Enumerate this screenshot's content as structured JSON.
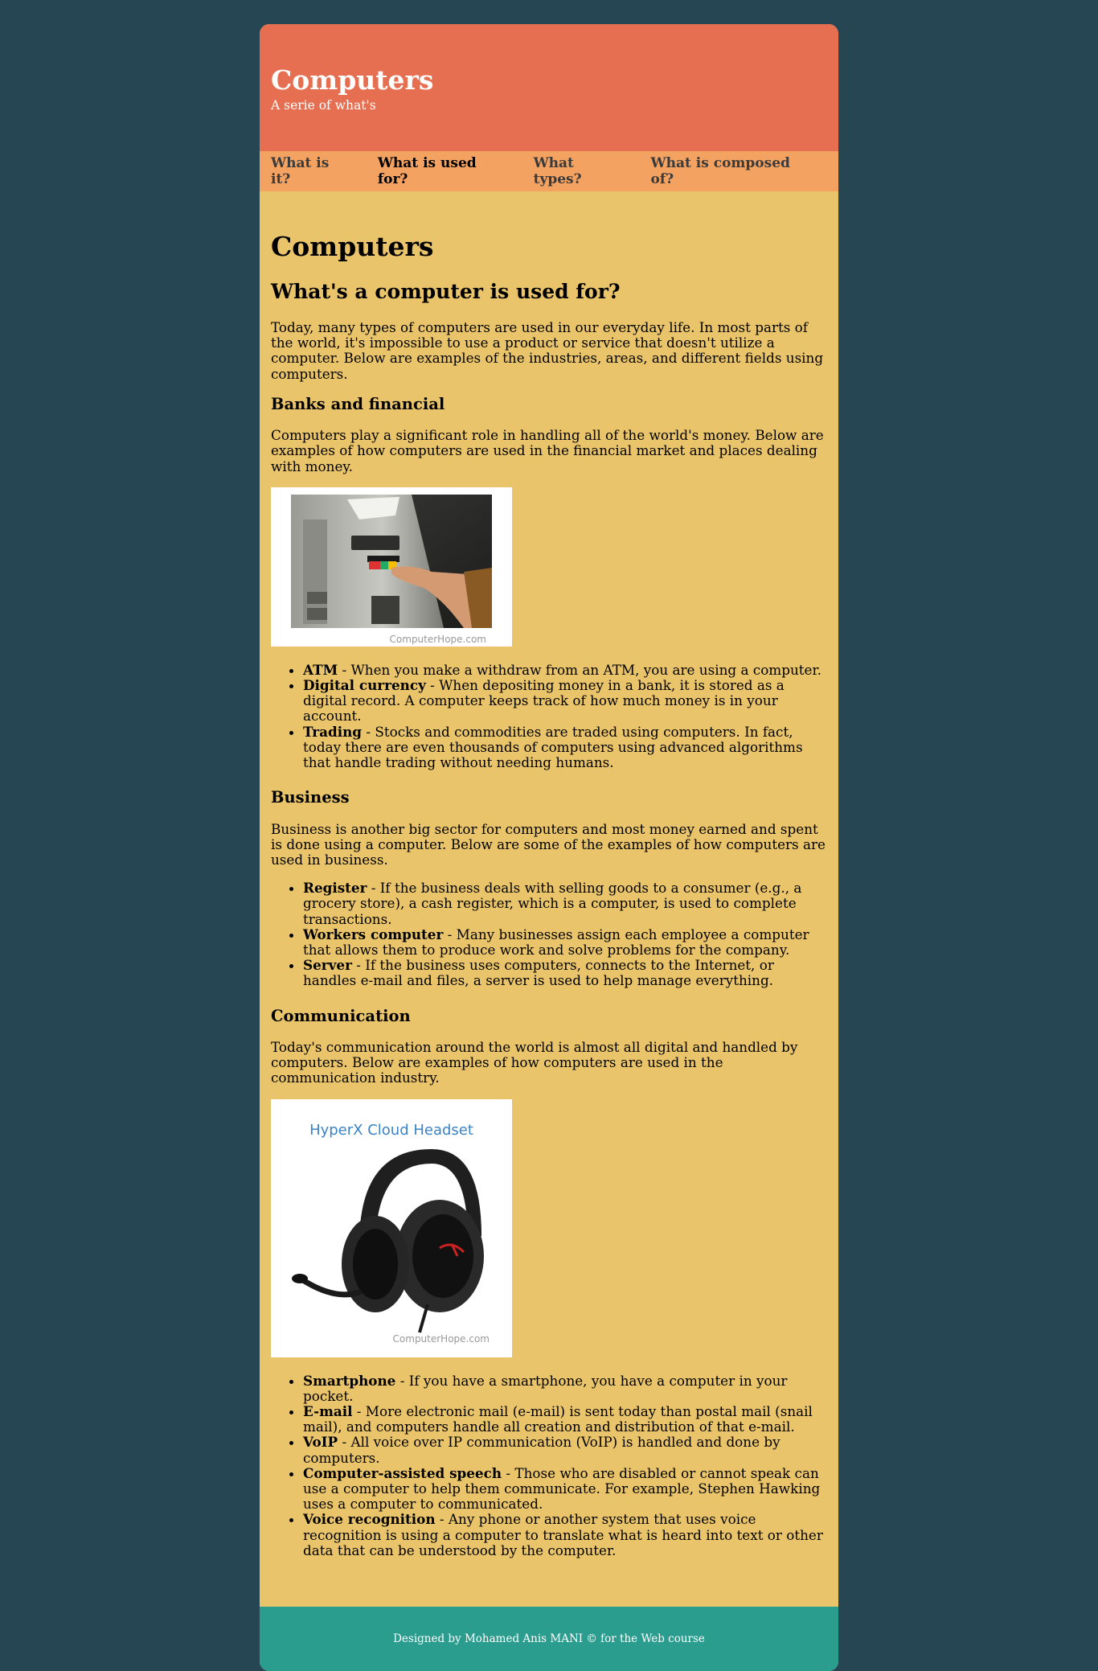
{
  "header": {
    "title": "Computers",
    "subtitle": "A serie of what's"
  },
  "nav": [
    {
      "label": "What is it?"
    },
    {
      "label": "What is used for?"
    },
    {
      "label": "What types?"
    },
    {
      "label": "What is composed of?"
    }
  ],
  "main": {
    "title": "Computers",
    "question": "What's a computer is used for?",
    "intro": "Today, many types of computers are used in our everyday life. In most parts of the world, it's impossible to use a product or service that doesn't utilize a computer. Below are examples of the industries, areas, and different fields using computers.",
    "banks": {
      "heading": "Banks and financial",
      "text": "Computers play a significant role in handling all of the world's money. Below are examples of how computers are used in the financial market and places dealing with money.",
      "image_caption": "ComputerHope.com",
      "items": [
        {
          "term": "ATM",
          "desc": " - When you make a withdraw from an ATM, you are using a computer."
        },
        {
          "term": "Digital currency",
          "desc": " - When depositing money in a bank, it is stored as a digital record. A computer keeps track of how much money is in your account."
        },
        {
          "term": "Trading",
          "desc": " - Stocks and commodities are traded using computers. In fact, today there are even thousands of computers using advanced algorithms that handle trading without needing humans."
        }
      ]
    },
    "business": {
      "heading": "Business",
      "text": "Business is another big sector for computers and most money earned and spent is done using a computer. Below are some of the examples of how computers are used in business.",
      "items": [
        {
          "term": "Register",
          "desc": " - If the business deals with selling goods to a consumer (e.g., a grocery store), a cash register, which is a computer, is used to complete transactions."
        },
        {
          "term": "Workers computer",
          "desc": " - Many businesses assign each employee a computer that allows them to produce work and solve problems for the company."
        },
        {
          "term": "Server",
          "desc": " - If the business uses computers, connects to the Internet, or handles e-mail and files, a server is used to help manage everything."
        }
      ]
    },
    "communication": {
      "heading": "Communication",
      "text": "Today's communication around the world is almost all digital and handled by computers. Below are examples of how computers are used in the communication industry.",
      "image_title": "HyperX Cloud Headset",
      "image_caption": "ComputerHope.com",
      "items": [
        {
          "term": "Smartphone",
          "desc": " - If you have a smartphone, you have a computer in your pocket."
        },
        {
          "term": "E-mail",
          "desc": " - More electronic mail (e-mail) is sent today than postal mail (snail mail), and computers handle all creation and distribution of that e-mail."
        },
        {
          "term": "VoIP",
          "desc": " - All voice over IP communication (VoIP) is handled and done by computers."
        },
        {
          "term": "Computer-assisted speech",
          "desc": " - Those who are disabled or cannot speak can use a computer to help them communicate. For example, Stephen Hawking uses a computer to communicated."
        },
        {
          "term": "Voice recognition",
          "desc": " - Any phone or another system that uses voice recognition is using a computer to translate what is heard into text or other data that can be understood by the computer."
        }
      ]
    }
  },
  "footer": {
    "text": "Designed by Mohamed Anis MANI © for the Web course"
  }
}
